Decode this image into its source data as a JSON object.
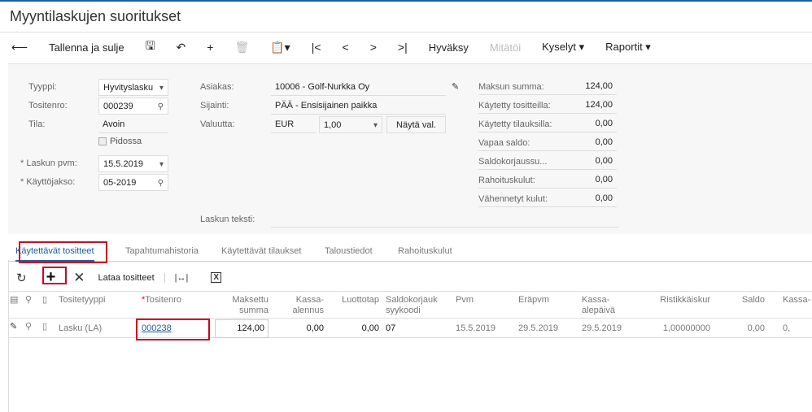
{
  "title": "Myyntilaskujen suoritukset",
  "toolbar": {
    "save_close": "Tallenna ja sulje",
    "approve": "Hyväksy",
    "void": "Mitätöi",
    "inquiries": "Kyselyt ▾",
    "reports": "Raportit ▾"
  },
  "form": {
    "type_label": "Tyyppi:",
    "type_value": "Hyvityslasku",
    "docno_label": "Tositenro:",
    "docno_value": "000239",
    "status_label": "Tila:",
    "status_value": "Avoin",
    "hold_label": "Pidossa",
    "date_label": "Laskun pvm:",
    "date_value": "15.5.2019",
    "period_label": "Käyttöjakso:",
    "period_value": "05-2019",
    "customer_label": "Asiakas:",
    "customer_value": "10006 - Golf-Nurkka Oy",
    "location_label": "Sijainti:",
    "location_value": "PÄÄ - Ensisijainen paikka",
    "currency_label": "Valuutta:",
    "currency_value": "EUR",
    "rate_value": "1,00",
    "show_rate": "Näytä val.",
    "text_label": "Laskun teksti:",
    "summary": [
      {
        "label": "Maksun summa:",
        "value": "124,00"
      },
      {
        "label": "Käytetty tositteilla:",
        "value": "124,00"
      },
      {
        "label": "Käytetty tilauksilla:",
        "value": "0,00"
      },
      {
        "label": "Vapaa saldo:",
        "value": "0,00"
      },
      {
        "label": "Saldokorjaussu...",
        "value": "0,00"
      },
      {
        "label": "Rahoituskulut:",
        "value": "0,00"
      },
      {
        "label": "Vähennetyt kulut:",
        "value": "0,00"
      }
    ]
  },
  "tabs": [
    "Käytettävät tositteet",
    "Tapahtumahistoria",
    "Käytettävät tilaukset",
    "Taloustiedot",
    "Rahoituskulut"
  ],
  "grid_toolbar": {
    "load": "Lataa tositteet"
  },
  "columns": [
    "Tositetyyppi",
    "Tositenro",
    "Maksettu summa",
    "Kassa-alennus",
    "Luottotap",
    "Saldokorjauk syykoodi",
    "Pvm",
    "Eräpvm",
    "Kassa-alepäivä",
    "Ristikkäiskur",
    "Saldo",
    "Kassa-"
  ],
  "rows": [
    [
      "Lasku (LA)",
      "000238",
      "124,00",
      "0,00",
      "0,00",
      "07",
      "15.5.2019",
      "29.5.2019",
      "29.5.2019",
      "1,00000000",
      "0,00",
      "0,"
    ]
  ]
}
